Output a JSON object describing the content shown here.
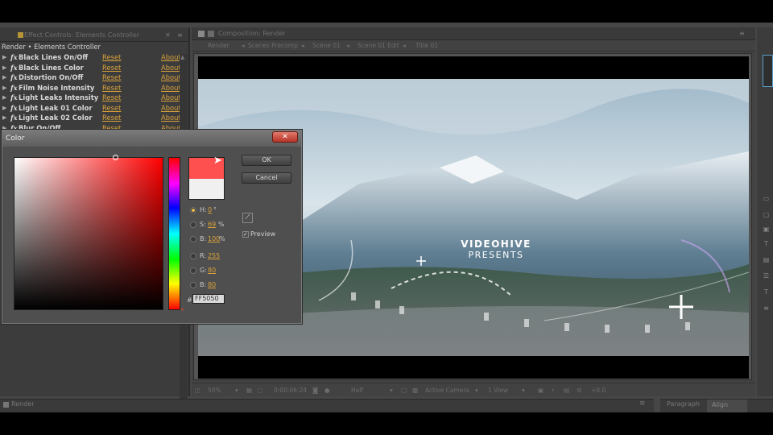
{
  "effect_controls": {
    "tab_title": "Effect Controls: Elements Controller",
    "breadcrumb": "Render • Elements Controller",
    "effects": [
      {
        "name": "Black Lines On/Off",
        "reset": "Reset",
        "about": "About"
      },
      {
        "name": "Black Lines Color",
        "reset": "Reset",
        "about": "About"
      },
      {
        "name": "Distortion On/Off",
        "reset": "Reset",
        "about": "About"
      },
      {
        "name": "Film Noise Intensity",
        "reset": "Reset",
        "about": "About"
      },
      {
        "name": "Light Leaks Intensity",
        "reset": "Reset",
        "about": "About"
      },
      {
        "name": "Light Leak 01 Color",
        "reset": "Reset",
        "about": "About"
      },
      {
        "name": "Light Leak 02 Color",
        "reset": "Reset",
        "about": "About"
      },
      {
        "name": "Blur On/Off",
        "reset": "Reset",
        "about": "About"
      }
    ],
    "fx_glyph": "fx"
  },
  "composition": {
    "tab_title": "Composition: Render",
    "breadcrumbs": [
      "Render",
      "Scenes Precomp",
      "Scene 01",
      "Scene 01 Edit",
      "Title 01"
    ],
    "frame": {
      "title_line1": "VIDEOHIVE",
      "title_line2": "PRESENTS"
    },
    "status": {
      "zoom": "50%",
      "timecode": "0:00:06:24",
      "resolution": "Half",
      "camera": "Active Camera",
      "view": "1 View",
      "exposure": "+0.0"
    }
  },
  "bottom": {
    "left_tab": "Render",
    "right_tabs": [
      "Paragraph",
      "Align"
    ]
  },
  "color_dialog": {
    "title": "Color",
    "close_label": "✕",
    "ok_label": "OK",
    "cancel_label": "Cancel",
    "preview_label": "Preview",
    "preview_checked": true,
    "new_color": "#FF5050",
    "old_color": "#F0F0F0",
    "hue_base": "#FF0000",
    "fields": [
      {
        "label": "H:",
        "value": "0",
        "unit": "°",
        "selected": true
      },
      {
        "label": "S:",
        "value": "69",
        "unit": "%",
        "selected": false
      },
      {
        "label": "B:",
        "value": "100",
        "unit": "%",
        "selected": false
      },
      {
        "label": "R:",
        "value": "255",
        "unit": "",
        "selected": false
      },
      {
        "label": "G:",
        "value": "80",
        "unit": "",
        "selected": false
      },
      {
        "label": "B:",
        "value": "80",
        "unit": "",
        "selected": false
      }
    ],
    "hex_label": "#",
    "hex_value": "FF5050"
  },
  "accent_colors": {
    "link": "#D9A23A",
    "panel": "#464646"
  }
}
